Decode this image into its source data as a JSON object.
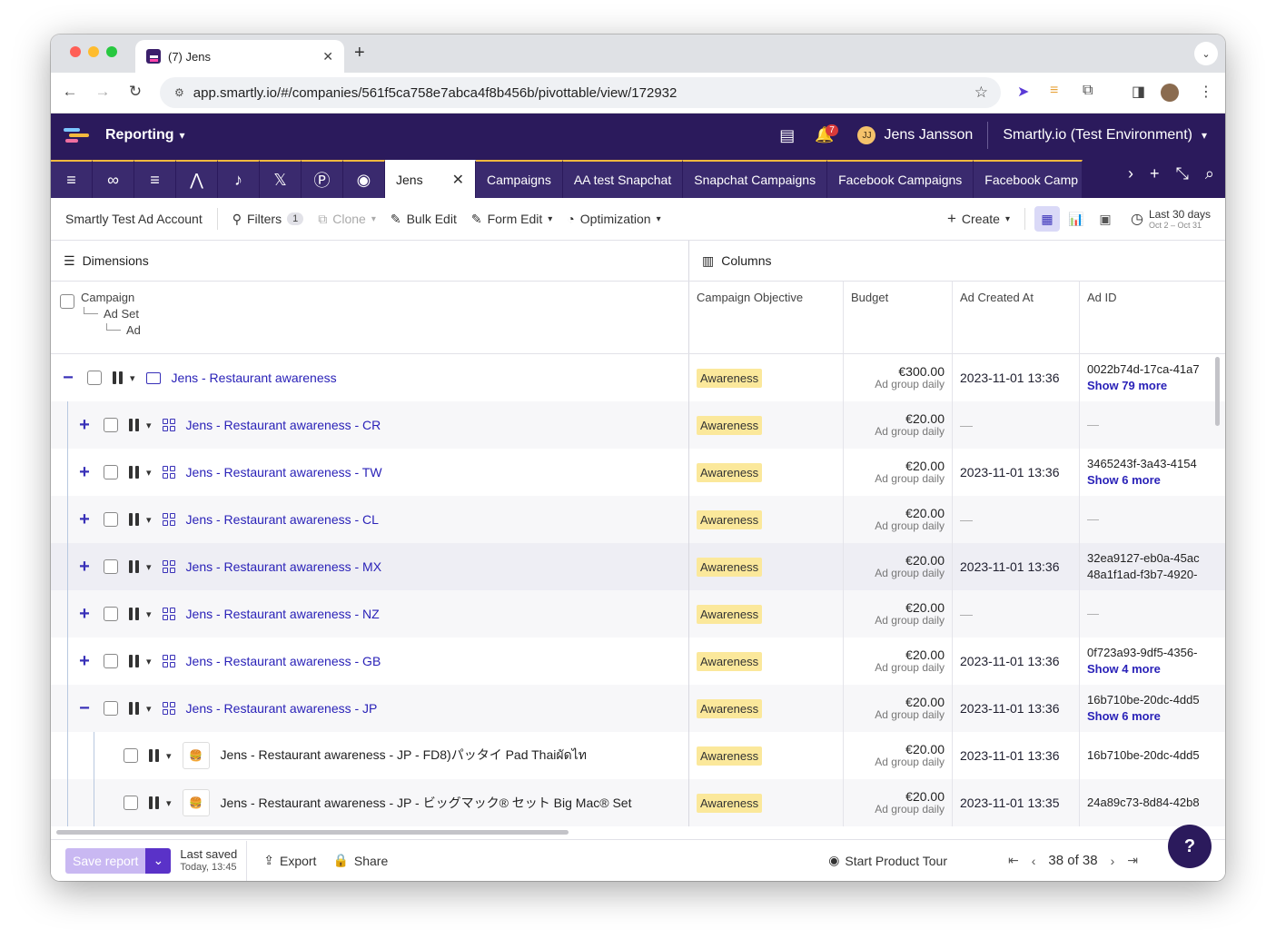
{
  "browser": {
    "tab_title": "(7) Jens",
    "url": "app.smartly.io/#/companies/561f5ca758e7abca4f8b456b/pivottable/view/172932"
  },
  "header": {
    "section": "Reporting",
    "notifications_count": "7",
    "user_initials": "JJ",
    "user_name": "Jens Jansson",
    "environment": "Smartly.io (Test Environment)"
  },
  "tabs": {
    "active": "Jens",
    "items": [
      "Campaigns",
      "AA test Snapchat",
      "Snapchat Campaigns",
      "Facebook Campaigns",
      "Facebook Camp"
    ]
  },
  "toolbar": {
    "account": "Smartly Test Ad Account",
    "filters": "Filters",
    "filters_count": "1",
    "clone": "Clone",
    "bulk_edit": "Bulk Edit",
    "form_edit": "Form Edit",
    "optimization": "Optimization",
    "create": "Create",
    "date_range": "Last 30 days",
    "date_sub": "Oct 2 – Oct 31"
  },
  "sections": {
    "dimensions": "Dimensions",
    "columns": "Columns"
  },
  "grid": {
    "hier": [
      "Campaign",
      "Ad Set",
      "Ad"
    ],
    "columns": [
      "Campaign Objective",
      "Budget",
      "Ad Created At",
      "Ad ID"
    ],
    "rows": [
      {
        "level": "campaign",
        "toggle": "−",
        "name": "Jens - Restaurant awareness",
        "objective": "Awareness",
        "budget": "€300.00",
        "budget_sub": "Ad group daily",
        "created": "2023-11-01 13:36",
        "adid": "0022b74d-17ca-41a7",
        "adid2": "Show 79 more",
        "adid2_link": true
      },
      {
        "level": "adset",
        "toggle": "+",
        "name": "Jens - Restaurant awareness - CR",
        "objective": "Awareness",
        "budget": "€20.00",
        "budget_sub": "Ad group daily",
        "created": "—",
        "adid": "—",
        "adid2": "",
        "adid2_link": false
      },
      {
        "level": "adset",
        "toggle": "+",
        "name": "Jens - Restaurant awareness - TW",
        "objective": "Awareness",
        "budget": "€20.00",
        "budget_sub": "Ad group daily",
        "created": "2023-11-01 13:36",
        "adid": "3465243f-3a43-4154",
        "adid2": "Show 6 more",
        "adid2_link": true
      },
      {
        "level": "adset",
        "toggle": "+",
        "name": "Jens - Restaurant awareness - CL",
        "objective": "Awareness",
        "budget": "€20.00",
        "budget_sub": "Ad group daily",
        "created": "—",
        "adid": "—",
        "adid2": "",
        "adid2_link": false
      },
      {
        "level": "adset",
        "toggle": "+",
        "name": "Jens - Restaurant awareness - MX",
        "objective": "Awareness",
        "budget": "€20.00",
        "budget_sub": "Ad group daily",
        "created": "2023-11-01 13:36",
        "adid": "32ea9127-eb0a-45ac",
        "adid2": "48a1f1ad-f3b7-4920-",
        "adid2_link": false
      },
      {
        "level": "adset",
        "toggle": "+",
        "name": "Jens - Restaurant awareness - NZ",
        "objective": "Awareness",
        "budget": "€20.00",
        "budget_sub": "Ad group daily",
        "created": "—",
        "adid": "—",
        "adid2": "",
        "adid2_link": false
      },
      {
        "level": "adset",
        "toggle": "+",
        "name": "Jens - Restaurant awareness - GB",
        "objective": "Awareness",
        "budget": "€20.00",
        "budget_sub": "Ad group daily",
        "created": "2023-11-01 13:36",
        "adid": "0f723a93-9df5-4356-",
        "adid2": "Show 4 more",
        "adid2_link": true
      },
      {
        "level": "adset",
        "toggle": "−",
        "name": "Jens - Restaurant awareness - JP",
        "objective": "Awareness",
        "budget": "€20.00",
        "budget_sub": "Ad group daily",
        "created": "2023-11-01 13:36",
        "adid": "16b710be-20dc-4dd5",
        "adid2": "Show 6 more",
        "adid2_link": true
      },
      {
        "level": "ad",
        "toggle": "",
        "name": "Jens - Restaurant awareness - JP - FD8)パッタイ Pad Thaiผัดไท",
        "objective": "Awareness",
        "budget": "€20.00",
        "budget_sub": "Ad group daily",
        "created": "2023-11-01 13:36",
        "adid": "16b710be-20dc-4dd5",
        "adid2": "",
        "adid2_link": false
      },
      {
        "level": "ad",
        "toggle": "",
        "name": "Jens - Restaurant awareness - JP - ビッグマック® セット Big Mac® Set",
        "objective": "Awareness",
        "budget": "€20.00",
        "budget_sub": "Ad group daily",
        "created": "2023-11-01 13:35",
        "adid": "24a89c73-8d84-42b8",
        "adid2": "",
        "adid2_link": false
      }
    ]
  },
  "footer": {
    "save": "Save report",
    "last_saved": "Last saved",
    "last_saved_time": "Today, 13:45",
    "export": "Export",
    "share": "Share",
    "tour": "Start Product Tour",
    "page": "38 of 38"
  }
}
